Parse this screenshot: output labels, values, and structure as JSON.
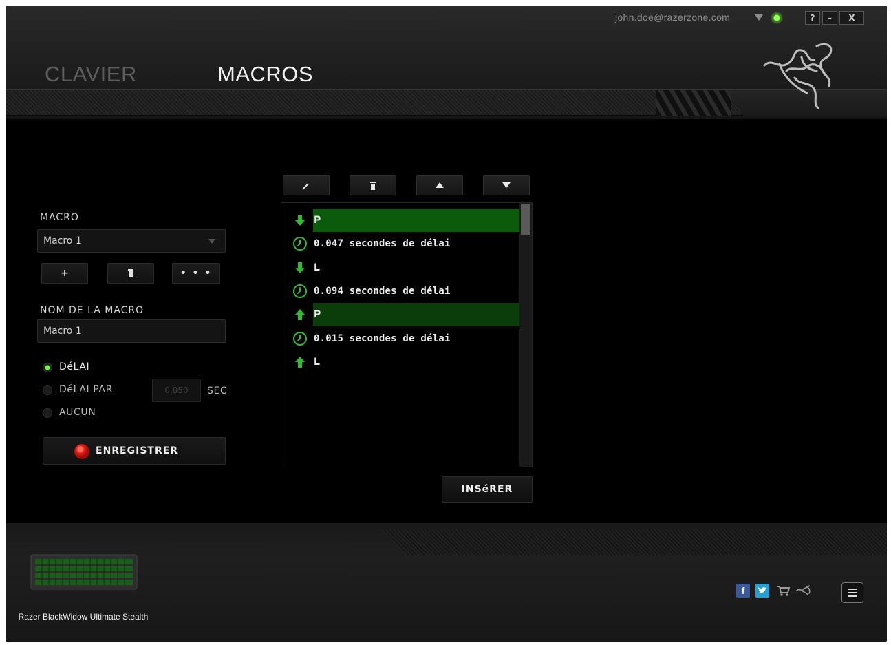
{
  "header": {
    "tabs": [
      {
        "label": "CLAVIER",
        "active": false
      },
      {
        "label": "MACROS",
        "active": true
      }
    ],
    "user_email": "john.doe@razerzone.com",
    "window_buttons": {
      "help": "?",
      "minimize": "–",
      "close": "X"
    },
    "status_color": "#6cff3c"
  },
  "left_panel": {
    "macro_label": "MACRO",
    "macro_select_value": "Macro 1",
    "buttons": {
      "add": "+",
      "delete": "🗑",
      "more": "• • •"
    },
    "name_label": "NOM DE LA MACRO",
    "name_value": "Macro 1",
    "delay_options": [
      {
        "label": "DéLAI",
        "selected": true
      },
      {
        "label": "DéLAI PAR",
        "selected": false
      },
      {
        "label": "AUCUN",
        "selected": false
      }
    ],
    "delay_value": "0.050",
    "delay_unit": "SEC",
    "record_label": "ENREGISTRER"
  },
  "center_panel": {
    "toolbar": {
      "edit": "✎",
      "delete": "🗑",
      "up": "▲",
      "down": "▼"
    },
    "events": [
      {
        "type": "key-down",
        "text": "P",
        "highlight": "strong"
      },
      {
        "type": "delay",
        "text": "0.047 secondes de délai",
        "highlight": "none"
      },
      {
        "type": "key-down",
        "text": "L",
        "highlight": "none"
      },
      {
        "type": "delay",
        "text": "0.094 secondes de délai",
        "highlight": "none"
      },
      {
        "type": "key-up",
        "text": "P",
        "highlight": "weak"
      },
      {
        "type": "delay",
        "text": "0.015 secondes de délai",
        "highlight": "none"
      },
      {
        "type": "key-up",
        "text": "L",
        "highlight": "none"
      }
    ],
    "insert_label": "INSéRER"
  },
  "footer": {
    "device_name": "Razer BlackWidow Ultimate Stealth",
    "social_icons": [
      "facebook-icon",
      "twitter-icon",
      "store-icon",
      "razer-icon"
    ],
    "accent_color": "#2fbd2f",
    "record_color": "#e21b14"
  }
}
